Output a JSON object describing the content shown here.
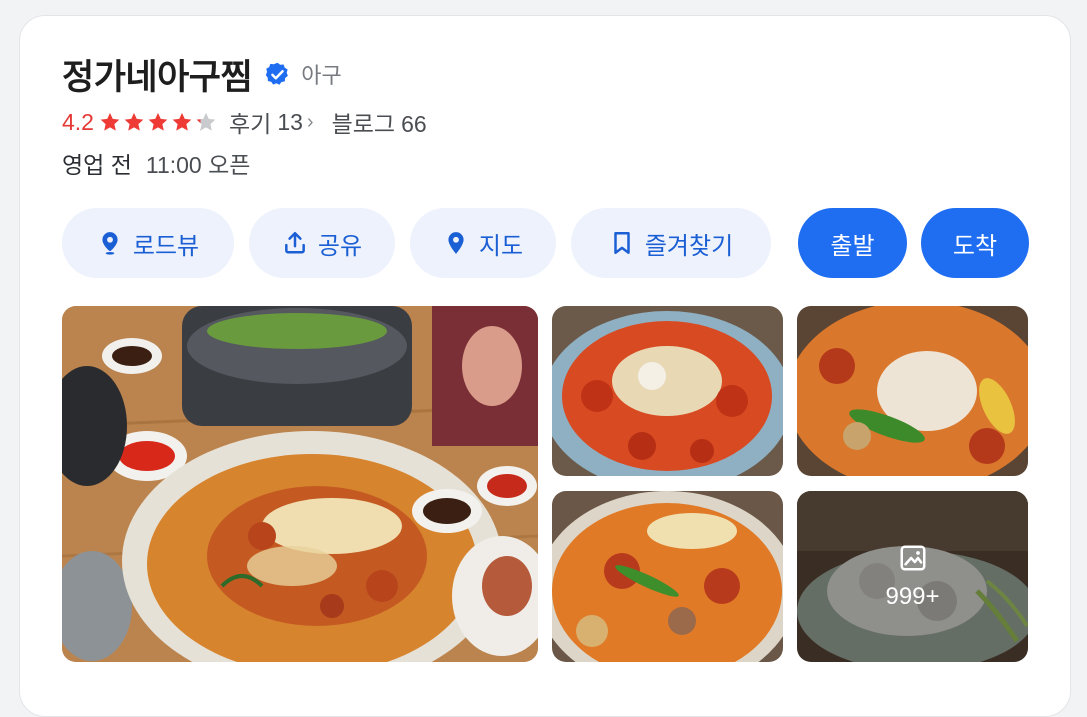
{
  "place": {
    "name": "정가네아구찜",
    "category": "아구"
  },
  "rating": {
    "score": "4.2",
    "stars": 4.2,
    "reviews_label": "후기",
    "reviews_count": "13",
    "blog_label": "블로그",
    "blog_count": "66"
  },
  "hours": {
    "status": "영업 전",
    "open_time": "11:00 오픈"
  },
  "actions": {
    "roadview": "로드뷰",
    "share": "공유",
    "map": "지도",
    "bookmark": "즐겨찾기",
    "depart": "출발",
    "arrive": "도착"
  },
  "photos": {
    "more_count": "999+"
  },
  "colors": {
    "accent": "#1f6ef2",
    "rating": "#e53935",
    "star": "#ef3b36",
    "star_empty": "#c8cacd"
  }
}
